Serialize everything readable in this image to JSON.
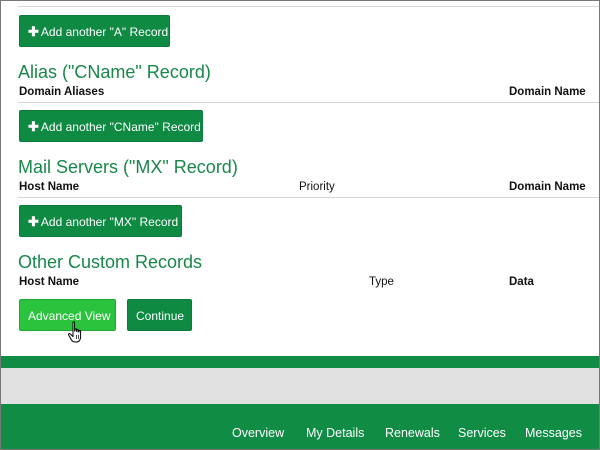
{
  "a_record": {
    "add_button_label": "Add another \"A\" Record"
  },
  "cname": {
    "title": "Alias (\"CName\" Record)",
    "columns": [
      "Domain Aliases",
      "Domain Name"
    ],
    "add_button_label": "Add another \"CName\" Record"
  },
  "mx": {
    "title": "Mail Servers (\"MX\" Record)",
    "columns": [
      "Host Name",
      "Priority",
      "Domain Name"
    ],
    "add_button_label": "Add another \"MX\" Record"
  },
  "custom": {
    "title": "Other Custom Records",
    "columns": [
      "Host Name",
      "Type",
      "Data"
    ]
  },
  "actions": {
    "advanced_view_label": "Advanced View",
    "continue_label": "Continue"
  },
  "footer": {
    "links": [
      "Overview",
      "My Details",
      "Renewals",
      "Services",
      "Messages"
    ]
  },
  "colors": {
    "primary_green": "#0e8a43",
    "highlight_green": "#2bc33e",
    "title_green": "#18884a"
  },
  "icons": {
    "add": "plus-icon",
    "cursor": "hand-pointer-icon"
  }
}
